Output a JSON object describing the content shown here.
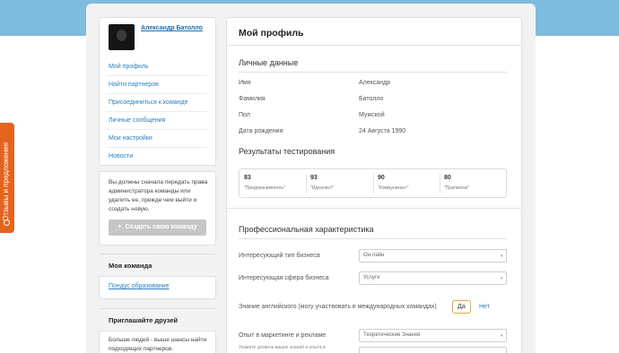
{
  "feedback_tab": {
    "label": "Отзывы и предложения",
    "color": "#e5641c"
  },
  "user": {
    "name": "Александр Батолло"
  },
  "nav": {
    "items": [
      {
        "label": "Мой профиль"
      },
      {
        "label": "Найти партнеров"
      },
      {
        "label": "Присоединиться к команде"
      },
      {
        "label": "Личные сообщения"
      },
      {
        "label": "Мои настройки"
      },
      {
        "label": "Новости"
      }
    ]
  },
  "admin_notice": {
    "text": "Вы должны сначала передать права администратора команды или удалить ее, прежде чем выйти и создать новую.",
    "button_label": "Создать свою команду"
  },
  "my_team": {
    "title": "Моя команда",
    "team_name": "Пондус образование"
  },
  "invite": {
    "title": "Приглашайте друзей",
    "text": "Больше людей - выше шансы найти подходящих партнеров."
  },
  "profile": {
    "title": "Мой профиль",
    "personal": {
      "title": "Личные данные",
      "fields": [
        {
          "label": "Имя",
          "value": "Александр"
        },
        {
          "label": "Фамилия",
          "value": "Батолло"
        },
        {
          "label": "Пол",
          "value": "Мужской"
        },
        {
          "label": "Дата рождения",
          "value": "24 Августа 1990"
        }
      ]
    },
    "testing": {
      "title": "Результаты тестирования",
      "scores": [
        {
          "value": "83",
          "label": "\"Предприниматель\""
        },
        {
          "value": "93",
          "label": "\"Идеалист\""
        },
        {
          "value": "90",
          "label": "\"Коммуникант\""
        },
        {
          "value": "80",
          "label": "\"Прагматик\""
        }
      ]
    },
    "professional": {
      "title": "Профессиональная характеристика",
      "business_type": {
        "label": "Интересующий тип бизнеса",
        "value": "Он-лайн"
      },
      "business_sphere": {
        "label": "Интересующая сфера бизнеса",
        "value": "Услуги"
      },
      "english": {
        "label": "Знание английского (могу участвовать в международных командах)",
        "yes": "Да",
        "no": "Нет"
      },
      "marketing": {
        "label": "Опыт в маркетинге и рекламе",
        "value": "Теоретические Знания",
        "hint": "Укажите уровень ваших знаний и опыта в"
      }
    }
  },
  "colors": {
    "header_band": "#7fbbdc",
    "link": "#2a7fc0",
    "accent_orange": "#e5641c"
  }
}
